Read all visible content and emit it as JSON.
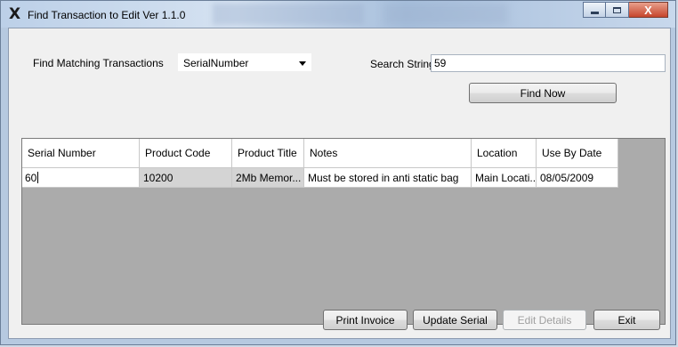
{
  "window": {
    "title": "Find Transaction to Edit Ver 1.1.0",
    "close_glyph": "X"
  },
  "search": {
    "match_label": "Find Matching Transactions",
    "field_selected": "SerialNumber",
    "string_label": "Search String",
    "string_value": "59",
    "find_button": "Find Now"
  },
  "grid": {
    "columns": [
      "Serial Number",
      "Product Code",
      "Product Title",
      "Notes",
      "Location",
      "Use By Date"
    ],
    "rows": [
      [
        "60",
        "10200",
        "2Mb Memor...",
        "Must be stored in anti static bag",
        "Main Locati...",
        "08/05/2009"
      ]
    ]
  },
  "buttons": {
    "print_invoice": "Print Invoice",
    "update_serial": "Update Serial",
    "edit_details": "Edit Details",
    "exit": "Exit"
  },
  "colors": {
    "title_bar": "#c3d4e8",
    "client_bg": "#f0f0f0",
    "grid_bg": "#ababab",
    "readonly_cell": "#d4d4d4",
    "close_button": "#c6452c"
  }
}
